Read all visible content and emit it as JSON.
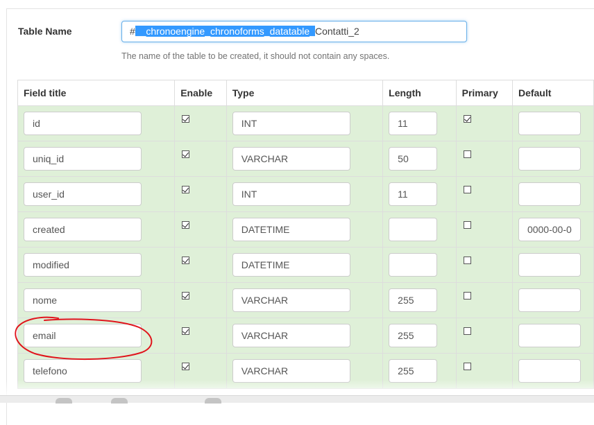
{
  "table_name": {
    "label": "Table Name",
    "value_prefix": "#",
    "value_selected": "__chronoengine_chronoforms_datatable_",
    "value_suffix": "Contatti_2",
    "help": "The name of the table to be created, it should not contain any spaces."
  },
  "columns": {
    "field_title": "Field title",
    "enable": "Enable",
    "type": "Type",
    "length": "Length",
    "primary": "Primary",
    "default": "Default"
  },
  "rows": [
    {
      "field": "id",
      "enable": true,
      "type": "INT",
      "length": "11",
      "primary": true,
      "default": ""
    },
    {
      "field": "uniq_id",
      "enable": true,
      "type": "VARCHAR",
      "length": "50",
      "primary": false,
      "default": ""
    },
    {
      "field": "user_id",
      "enable": true,
      "type": "INT",
      "length": "11",
      "primary": false,
      "default": ""
    },
    {
      "field": "created",
      "enable": true,
      "type": "DATETIME",
      "length": "",
      "primary": false,
      "default": "0000-00-0"
    },
    {
      "field": "modified",
      "enable": true,
      "type": "DATETIME",
      "length": "",
      "primary": false,
      "default": ""
    },
    {
      "field": "nome",
      "enable": true,
      "type": "VARCHAR",
      "length": "255",
      "primary": false,
      "default": ""
    },
    {
      "field": "email",
      "enable": true,
      "type": "VARCHAR",
      "length": "255",
      "primary": false,
      "default": ""
    },
    {
      "field": "telefono",
      "enable": true,
      "type": "VARCHAR",
      "length": "255",
      "primary": false,
      "default": ""
    }
  ],
  "colors": {
    "row_bg": "#dff0d8",
    "selection": "#3399ff",
    "annotation": "#e0141c"
  }
}
